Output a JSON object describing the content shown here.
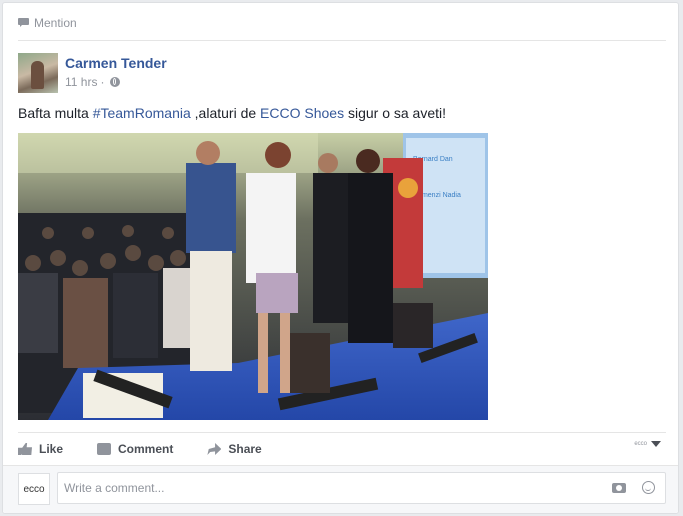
{
  "mention": {
    "label": "Mention"
  },
  "post": {
    "author": "Carmen Tender",
    "time": "11 hrs",
    "separator": "·",
    "text": {
      "part1": "Bafta multa ",
      "hashtag": "#TeamRomania",
      "part2": " ,alaturi de ",
      "page_link": "ECCO Shoes",
      "part3": " sigur o sa aveti!"
    },
    "photo": {
      "banner_line1": "Bernard Dan",
      "banner_line2": "Comenzi Nadia"
    }
  },
  "actions": {
    "like": "Like",
    "comment": "Comment",
    "share": "Share",
    "page_selector": "ecco"
  },
  "comment_box": {
    "avatar_text": "ecco",
    "placeholder": "Write a comment..."
  },
  "icons": [
    "mention-icon",
    "globe-icon",
    "like-icon",
    "comment-icon",
    "share-icon",
    "caret-down-icon",
    "camera-icon",
    "emoji-icon"
  ]
}
